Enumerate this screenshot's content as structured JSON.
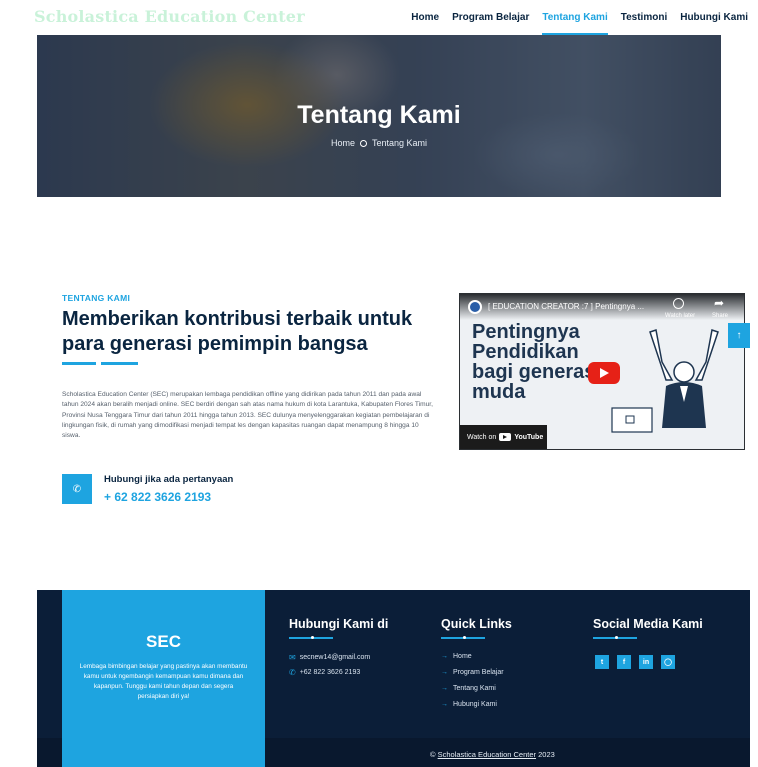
{
  "nav": {
    "brand": "Scholastica Education Center",
    "items": [
      {
        "label": "Home",
        "active": false
      },
      {
        "label": "Program Belajar",
        "active": false
      },
      {
        "label": "Tentang Kami",
        "active": true
      },
      {
        "label": "Testimoni",
        "active": false
      },
      {
        "label": "Hubungi Kami",
        "active": false
      }
    ]
  },
  "hero": {
    "title": "Tentang Kami",
    "breadcrumb_home": "Home",
    "breadcrumb_current": "Tentang Kami"
  },
  "about": {
    "eyebrow": "TENTANG KAMI",
    "headline": "Memberikan kontribusi terbaik untuk para generasi pemimpin bangsa",
    "body": "Scholastica Education Center (SEC) merupakan lembaga pendidikan offline yang didirikan pada tahun 2011 dan pada awal tahun 2024 akan beralih menjadi online. SEC berdiri dengan sah atas nama hukum di kota Larantuka, Kabupaten Flores Timur, Provinsi Nusa Tenggara Timur dari tahun 2011 hingga tahun 2013. SEC dulunya menyelenggarakan kegiatan pembelajaran di lingkungan fisik, di rumah yang dimodifikasi menjadi tempat les dengan kapasitas ruangan dapat menampung 8 hingga 10 siswa.",
    "call_label": "Hubungi jika ada pertanyaan",
    "call_number": "+ 62 822 3626 2193"
  },
  "video": {
    "title": "[ EDUCATION CREATOR :7 ] Pentingnya ...",
    "watch_later": "Watch later",
    "share": "Share",
    "big_text": "Pentingnya Pendidikan bagi generasi muda",
    "watch_on": "Watch on",
    "youtube": "YouTube"
  },
  "footer": {
    "sec_title": "SEC",
    "sec_desc": "Lembaga bimbingan belajar yang pastinya akan membantu kamu untuk ngembangin kemampuan kamu dimana dan kapanpun. Tunggu kami tahun depan dan segera persiapkan diri ya!",
    "contact_title": "Hubungi Kami di",
    "email": "secnew14@gmail.com",
    "phone": "+62 822 3626 2193",
    "quick_title": "Quick Links",
    "quick_links": [
      "Home",
      "Program Belajar",
      "Tentang Kami",
      "Hubungi Kami"
    ],
    "social_title": "Social Media Kami",
    "socials": [
      "twitter-icon",
      "facebook-icon",
      "linkedin-icon",
      "instagram-icon"
    ],
    "copyright_symbol": "©",
    "copyright_brand": "Scholastica Education Center",
    "copyright_year": "2023"
  },
  "colors": {
    "accent": "#1ea4e0",
    "navy": "#0b1e38",
    "brand": "#c9f2d9"
  }
}
